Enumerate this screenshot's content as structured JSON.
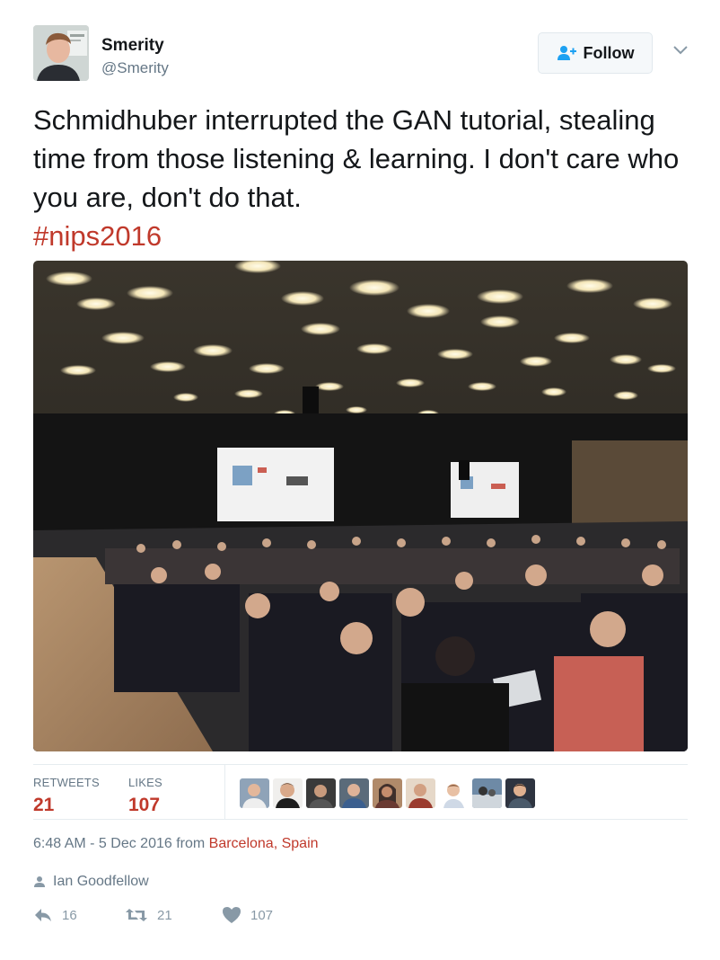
{
  "author": {
    "name": "Smerity",
    "handle": "@Smerity"
  },
  "follow_button": {
    "label": "Follow"
  },
  "tweet": {
    "text": "Schmidhuber interrupted the GAN tutorial, stealing time from those listening & learning. I don't care who you are, don't do that.",
    "hashtag": "#nips2016"
  },
  "stats": {
    "retweets_label": "RETWEETS",
    "retweets_count": "21",
    "likes_label": "LIKES",
    "likes_count": "107",
    "likers_count": 9
  },
  "timestamp": {
    "time": "6:48 AM - 5 Dec 2016 from ",
    "place": "Barcelona, Spain"
  },
  "context": {
    "user": "Ian Goodfellow"
  },
  "actions": {
    "reply_count": "16",
    "retweet_count": "21",
    "like_count": "107"
  },
  "colors": {
    "accent": "#c0392b",
    "secondary_text": "#657786",
    "border": "#e6ecf0"
  },
  "icons": [
    "follow-person-icon",
    "chevron-down-icon",
    "person-icon",
    "reply-icon",
    "retweet-icon",
    "heart-icon"
  ]
}
